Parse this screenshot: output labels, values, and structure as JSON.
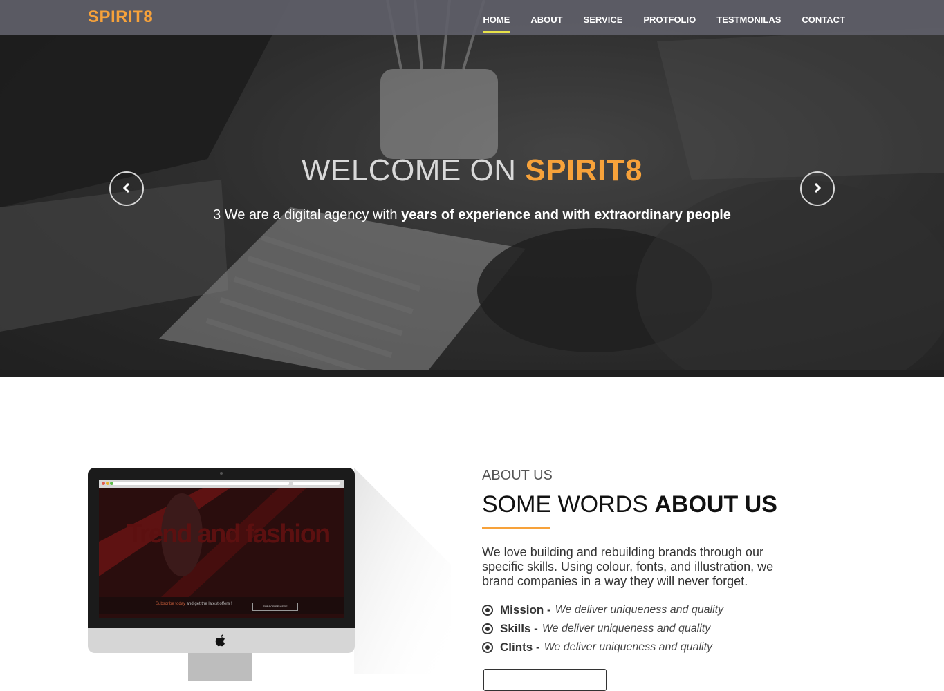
{
  "brand": "SPIRIT8",
  "nav": {
    "items": [
      {
        "label": "HOME",
        "active": true
      },
      {
        "label": "ABOUT"
      },
      {
        "label": "SERVICE"
      },
      {
        "label": "PROTFOLIO"
      },
      {
        "label": "TESTMONILAS"
      },
      {
        "label": "CONTACT"
      }
    ]
  },
  "hero": {
    "title_prefix": "WELCOME ON ",
    "title_accent": "SPIRIT8",
    "subtitle_plain": "3 We are a digital agency with ",
    "subtitle_bold": "years of experience and with extraordinary people",
    "prev_icon": "chevron-left-icon",
    "next_icon": "chevron-right-icon"
  },
  "about": {
    "kicker": "ABOUT US",
    "title_plain": "SOME WORDS ",
    "title_bold": "ABOUT US",
    "text": "We love building and rebuilding brands through our specific skills. Using colour, fonts, and illustration, we brand companies in a way they will never forget.",
    "list": [
      {
        "key": "Mission -",
        "desc": "We deliver uniqueness and quality"
      },
      {
        "key": "Skills -",
        "desc": "We deliver uniqueness and quality"
      },
      {
        "key": "Clints -",
        "desc": "We deliver uniqueness and quality"
      }
    ]
  },
  "screen": {
    "headline": "Trend and fashion",
    "sub_highlight": "Subscribe today",
    "sub_text": " and get the latest offers !",
    "button": "SUBSCRIBE HERE"
  },
  "colors": {
    "accent": "#f7a23a",
    "nav_active_underline": "#e8e24a"
  }
}
